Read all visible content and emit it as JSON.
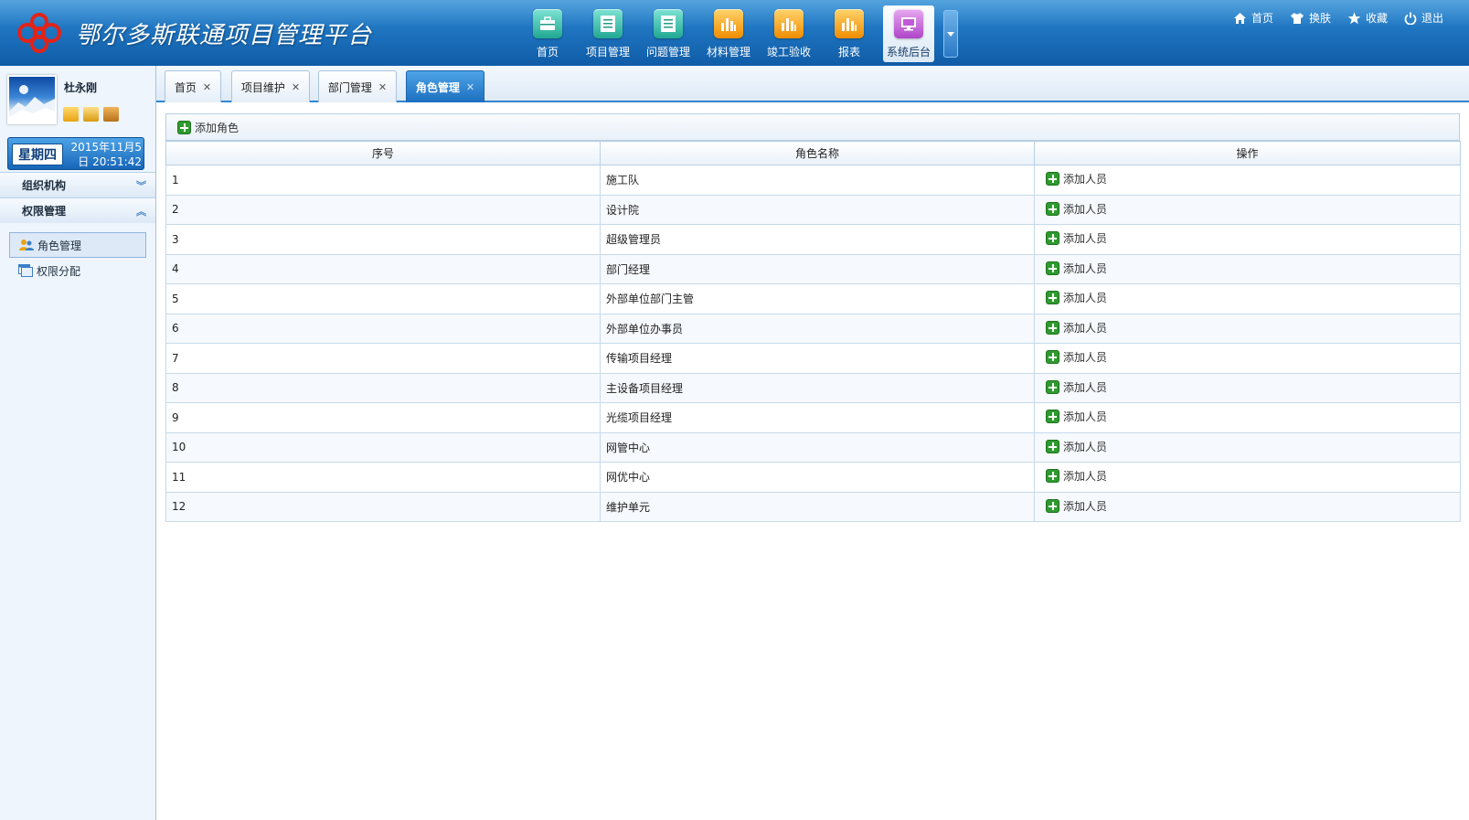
{
  "app": {
    "title": "鄂尔多斯联通项目管理平台"
  },
  "topnav": [
    {
      "label": "首页",
      "icon": "briefcase-icon",
      "color": "#20a892"
    },
    {
      "label": "项目管理",
      "icon": "document-icon",
      "color": "#20a892"
    },
    {
      "label": "问题管理",
      "icon": "document-icon",
      "color": "#20a892"
    },
    {
      "label": "材料管理",
      "icon": "bar-chart-icon",
      "color": "#f08c00"
    },
    {
      "label": "竣工验收",
      "icon": "bar-chart-icon",
      "color": "#f08c00"
    },
    {
      "label": "报表",
      "icon": "bar-chart-icon",
      "color": "#f08c00"
    },
    {
      "label": "系统后台",
      "icon": "monitor-icon",
      "color": "#b044c9",
      "active": true
    }
  ],
  "toplinks": [
    {
      "label": "首页",
      "icon": "home-icon"
    },
    {
      "label": "换肤",
      "icon": "shirt-icon"
    },
    {
      "label": "收藏",
      "icon": "star-icon"
    },
    {
      "label": "退出",
      "icon": "power-icon"
    }
  ],
  "user": {
    "name": "杜永刚",
    "weekday": "星期四",
    "date": "2015年11月5日 20:51:42"
  },
  "sidebar": {
    "sections": [
      {
        "label": "组织机构",
        "expanded": false
      },
      {
        "label": "权限管理",
        "expanded": true
      }
    ],
    "items": [
      {
        "label": "角色管理",
        "icon": "users-icon",
        "active": true
      },
      {
        "label": "权限分配",
        "icon": "window-icon",
        "active": false
      }
    ]
  },
  "tabs": [
    {
      "label": "首页"
    },
    {
      "label": "项目维护"
    },
    {
      "label": "部门管理"
    },
    {
      "label": "角色管理",
      "active": true
    }
  ],
  "toolbar": {
    "add_role": "添加角色"
  },
  "table": {
    "headers": [
      "序号",
      "角色名称",
      "操作"
    ],
    "action_label": "添加人员",
    "rows": [
      {
        "no": "1",
        "name": "施工队"
      },
      {
        "no": "2",
        "name": "设计院"
      },
      {
        "no": "3",
        "name": "超级管理员"
      },
      {
        "no": "4",
        "name": "部门经理"
      },
      {
        "no": "5",
        "name": "外部单位部门主管"
      },
      {
        "no": "6",
        "name": "外部单位办事员"
      },
      {
        "no": "7",
        "name": "传输项目经理"
      },
      {
        "no": "8",
        "name": "主设备项目经理"
      },
      {
        "no": "9",
        "name": "光缆项目经理"
      },
      {
        "no": "10",
        "name": "网管中心"
      },
      {
        "no": "11",
        "name": "网优中心"
      },
      {
        "no": "12",
        "name": "维护单元"
      }
    ]
  }
}
